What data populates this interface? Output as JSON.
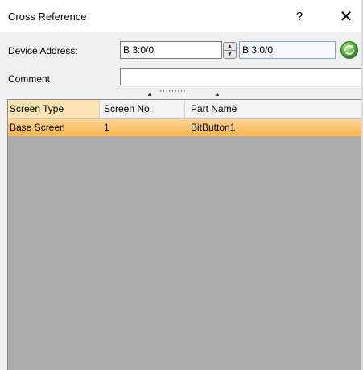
{
  "window": {
    "title": "Cross Reference",
    "help_label": "?",
    "close_label": "✕"
  },
  "form": {
    "device_address_label": "Device Address:",
    "device_address_from": "B 3:0/0",
    "device_address_to": "B 3:0/0",
    "comment_label": "Comment",
    "comment_value": ""
  },
  "icons": {
    "spin_up": "up-arrow-icon",
    "spin_down": "down-arrow-icon",
    "go": "refresh-go-icon",
    "go_color": "#3da331"
  },
  "splitter": {
    "dots": "·········"
  },
  "grid": {
    "columns": [
      "Screen Type",
      "Screen No.",
      "Part Name"
    ],
    "rows": [
      {
        "screen_type": "Base Screen",
        "screen_no": "1",
        "part_name": "BitButton1"
      }
    ],
    "selected_row_color": "#fbb54a",
    "empty_area_color": "#ababab"
  }
}
